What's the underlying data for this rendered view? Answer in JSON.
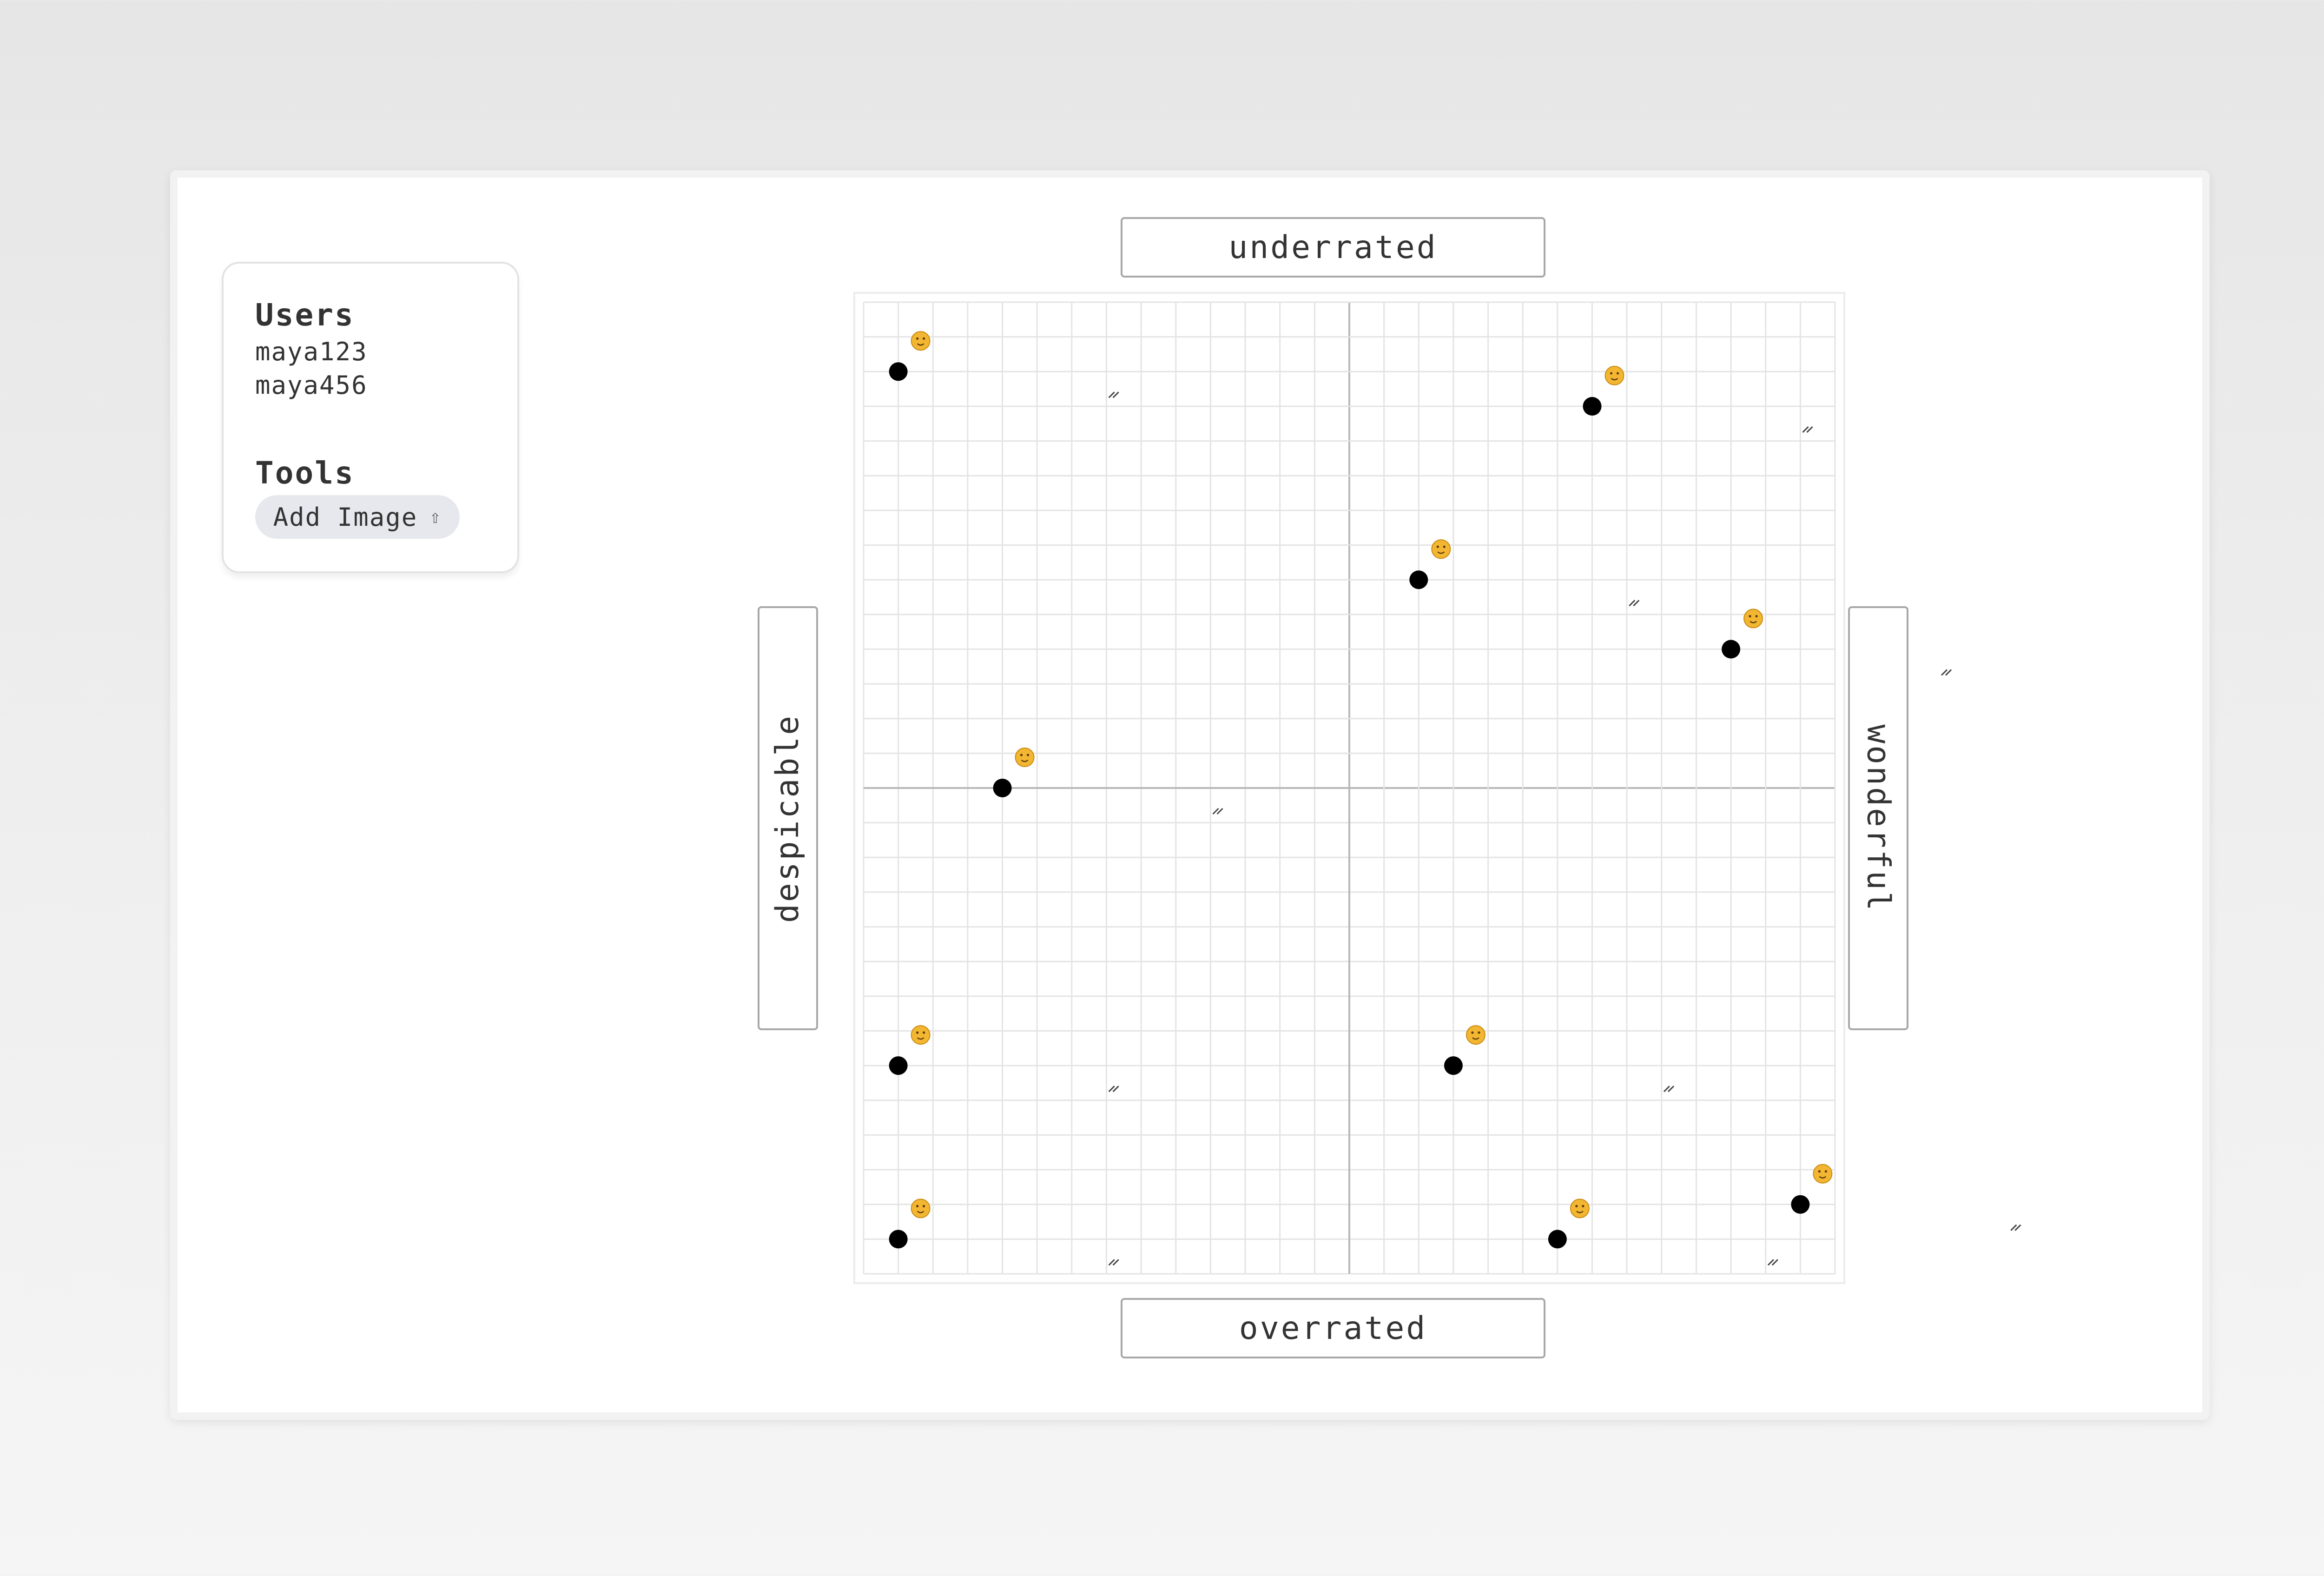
{
  "sidebar": {
    "users_heading": "Users",
    "users": [
      "maya123",
      "maya456"
    ],
    "tools_heading": "Tools",
    "add_image_label": "Add Image",
    "add_image_icon": "⇧"
  },
  "axes": {
    "top": "underrated",
    "bottom": "overrated",
    "left": "despicable",
    "right": "wonderful"
  },
  "colors": {
    "point": "#000000",
    "grid_minor": "#e4e4e4",
    "grid_axis": "#b8b8b8",
    "emoji_fill": "#f2b632"
  },
  "chart_data": {
    "type": "scatter",
    "xlabel_left": "despicable",
    "xlabel_right": "wonderful",
    "ylabel_top": "underrated",
    "ylabel_bottom": "overrated",
    "xlim": [
      -14,
      14
    ],
    "ylim": [
      -14,
      14
    ],
    "grid": true,
    "points": [
      {
        "icon": "astonished-face-emoji",
        "x": -13,
        "y": 12
      },
      {
        "icon": "pumpkin-emoji",
        "x": 7,
        "y": 11
      },
      {
        "icon": "relieved-face-emoji",
        "x": 2,
        "y": 6
      },
      {
        "icon": "tongue-face-emoji",
        "x": 11,
        "y": 4
      },
      {
        "icon": "angry-face-emoji",
        "x": -10,
        "y": 0
      },
      {
        "icon": "nauseated-face-emoji",
        "x": -13,
        "y": -8
      },
      {
        "icon": "dancers-emoji",
        "x": 3,
        "y": -8
      },
      {
        "icon": "laughing-face-emoji",
        "x": -13,
        "y": -13
      },
      {
        "icon": "star-struck-face-emoji",
        "x": 6,
        "y": -13
      },
      {
        "icon": "crying-cat-emoji",
        "x": 13,
        "y": -12
      }
    ]
  }
}
